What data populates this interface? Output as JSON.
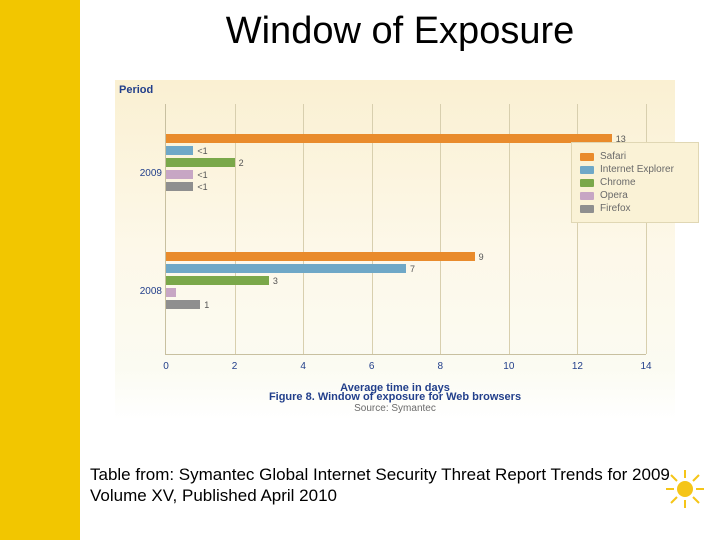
{
  "slide": {
    "title": "Window of Exposure",
    "citation_line1": "Table from: Symantec Global Internet Security Threat Report Trends for 2009",
    "citation_line2": "Volume XV, Published April 2010"
  },
  "figure": {
    "y_axis_title": "Period",
    "x_axis_title": "Average time in days",
    "caption_bold": "Figure 8. Window of exposure for Web browsers",
    "caption_source": "Source: Symantec",
    "group_labels": {
      "g2009": "2009",
      "g2008": "2008"
    }
  },
  "legend": {
    "items": [
      {
        "name": "Safari",
        "color": "#e98b2c"
      },
      {
        "name": "Internet Explorer",
        "color": "#6fa8c7"
      },
      {
        "name": "Chrome",
        "color": "#7aa84a"
      },
      {
        "name": "Opera",
        "color": "#c7a6c4"
      },
      {
        "name": "Firefox",
        "color": "#8f8f8f"
      }
    ]
  },
  "chart_data": {
    "type": "bar",
    "orientation": "horizontal",
    "xlabel": "Average time in days",
    "ylabel": "Period",
    "title": "Window of exposure for Web browsers",
    "xlim": [
      0,
      14
    ],
    "ticks": [
      0,
      2,
      4,
      6,
      8,
      10,
      12,
      14
    ],
    "categories": [
      "2009",
      "2008"
    ],
    "series": [
      {
        "name": "Safari",
        "color": "#e98b2c",
        "values": [
          13,
          9
        ]
      },
      {
        "name": "Internet Explorer",
        "color": "#6fa8c7",
        "values": [
          0.8,
          7
        ]
      },
      {
        "name": "Chrome",
        "color": "#7aa84a",
        "values": [
          2,
          3
        ]
      },
      {
        "name": "Opera",
        "color": "#c7a6c4",
        "values": [
          0.8,
          0.3
        ]
      },
      {
        "name": "Firefox",
        "color": "#8f8f8f",
        "values": [
          0.8,
          1
        ]
      }
    ],
    "display_labels": [
      {
        "year": "2009",
        "labels": [
          "13",
          "<1",
          "2",
          "<1",
          "<1"
        ]
      },
      {
        "year": "2008",
        "labels": [
          "9",
          "7",
          "3",
          "",
          "1"
        ]
      }
    ]
  }
}
